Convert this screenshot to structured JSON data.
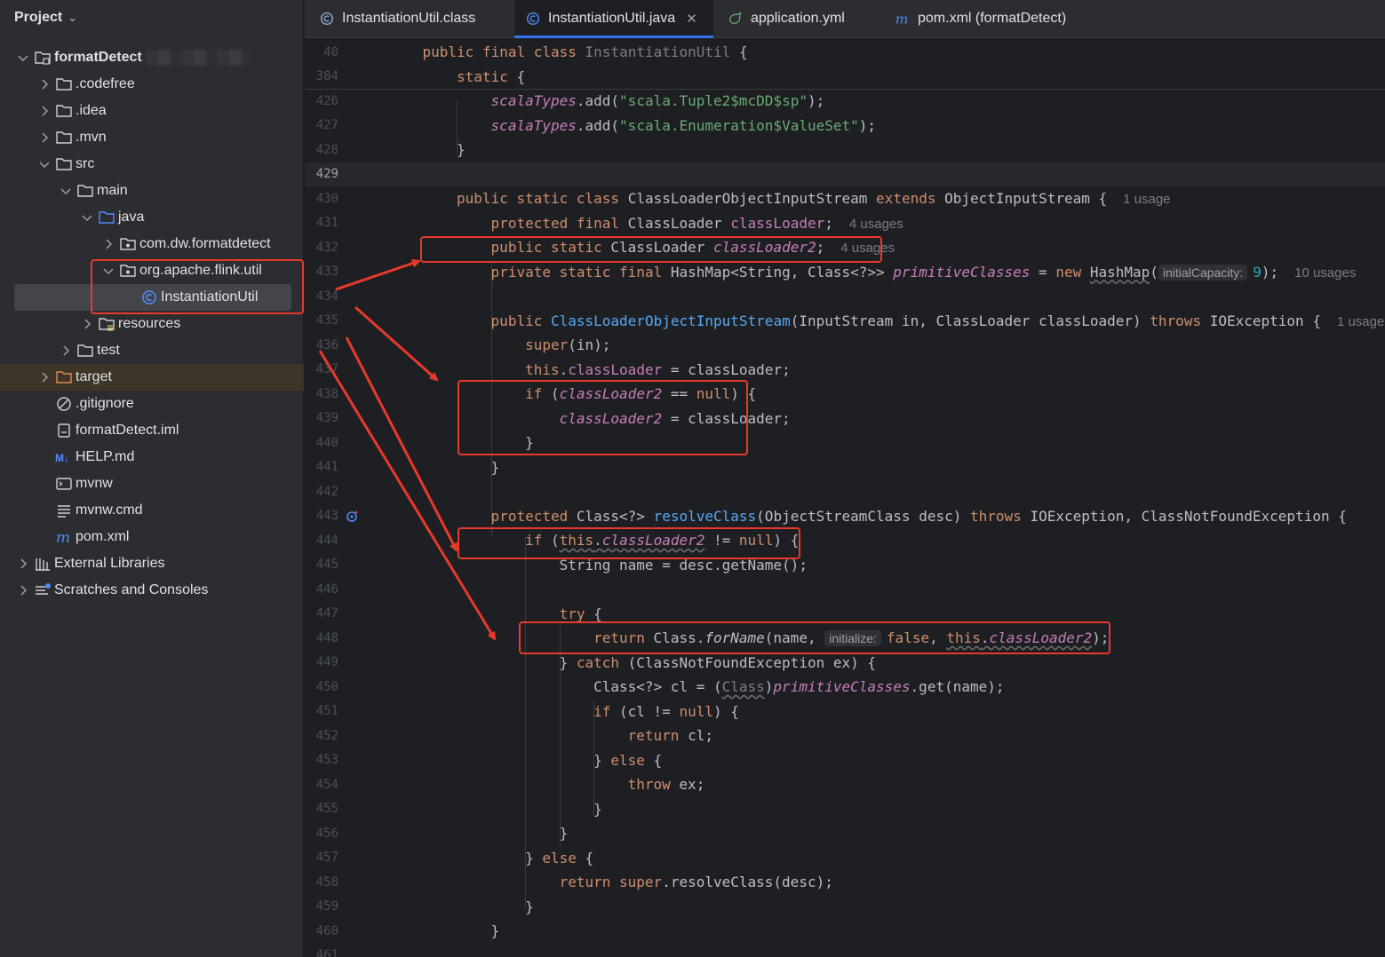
{
  "sidebar": {
    "title": "Project",
    "tree": [
      {
        "label": "formatDetect",
        "indent": 0,
        "expanded": true,
        "icon": "module-folder-icon",
        "bold": true,
        "blurred": true
      },
      {
        "label": ".codefree",
        "indent": 1,
        "expanded": false,
        "icon": "folder-icon"
      },
      {
        "label": ".idea",
        "indent": 1,
        "expanded": false,
        "icon": "folder-icon"
      },
      {
        "label": ".mvn",
        "indent": 1,
        "expanded": false,
        "icon": "folder-icon"
      },
      {
        "label": "src",
        "indent": 1,
        "expanded": true,
        "icon": "folder-icon"
      },
      {
        "label": "main",
        "indent": 2,
        "expanded": true,
        "icon": "folder-icon"
      },
      {
        "label": "java",
        "indent": 3,
        "expanded": true,
        "icon": "source-folder-icon"
      },
      {
        "label": "com.dw.formatdetect",
        "indent": 4,
        "expanded": false,
        "icon": "package-icon"
      },
      {
        "label": "org.apache.flink.util",
        "indent": 4,
        "expanded": true,
        "icon": "package-icon"
      },
      {
        "label": "InstantiationUtil",
        "indent": 5,
        "icon": "java-class-icon",
        "selected": true
      },
      {
        "label": "resources",
        "indent": 3,
        "expanded": false,
        "icon": "resources-folder-icon"
      },
      {
        "label": "test",
        "indent": 2,
        "expanded": false,
        "icon": "folder-icon"
      },
      {
        "label": "target",
        "indent": 1,
        "expanded": false,
        "icon": "excluded-folder-icon",
        "highlight": true
      },
      {
        "label": ".gitignore",
        "indent": 1,
        "icon": "ignore-file-icon"
      },
      {
        "label": "formatDetect.iml",
        "indent": 1,
        "icon": "iml-file-icon"
      },
      {
        "label": "HELP.md",
        "indent": 1,
        "icon": "markdown-icon"
      },
      {
        "label": "mvnw",
        "indent": 1,
        "icon": "terminal-file-icon"
      },
      {
        "label": "mvnw.cmd",
        "indent": 1,
        "icon": "text-file-icon"
      },
      {
        "label": "pom.xml",
        "indent": 1,
        "icon": "maven-icon"
      },
      {
        "label": "External Libraries",
        "indent": 0,
        "expanded": false,
        "icon": "libraries-icon"
      },
      {
        "label": "Scratches and Consoles",
        "indent": 0,
        "expanded": false,
        "icon": "scratches-icon"
      }
    ]
  },
  "tabs": [
    {
      "label": "InstantiationUtil.class",
      "icon": "class-file-icon"
    },
    {
      "label": "InstantiationUtil.java",
      "icon": "java-class-icon",
      "active": true
    },
    {
      "label": "application.yml",
      "icon": "yaml-icon"
    },
    {
      "label": "pom.xml (formatDetect)",
      "icon": "maven-icon"
    }
  ],
  "sticky_lines": [
    {
      "num": "40",
      "indent": 4,
      "tokens": [
        [
          "kw",
          "public final class "
        ],
        [
          "dim",
          "InstantiationUtil"
        ],
        [
          "",
          " {"
        ]
      ]
    },
    {
      "num": "384",
      "indent": 8,
      "tokens": [
        [
          "kw",
          "static"
        ],
        [
          "",
          " {"
        ]
      ]
    }
  ],
  "code_lines": [
    {
      "num": "426",
      "indent": 12,
      "tokens": [
        [
          "sfld",
          "scalaTypes"
        ],
        [
          "",
          ".add("
        ],
        [
          "str",
          "\"scala.Tuple2$mcDD$sp\""
        ],
        [
          "",
          ");"
        ]
      ]
    },
    {
      "num": "427",
      "indent": 12,
      "tokens": [
        [
          "sfld",
          "scalaTypes"
        ],
        [
          "",
          ".add("
        ],
        [
          "str",
          "\"scala.Enumeration$ValueSet\""
        ],
        [
          "",
          ");"
        ]
      ]
    },
    {
      "num": "428",
      "indent": 8,
      "tokens": [
        [
          "",
          "}"
        ]
      ]
    },
    {
      "num": "429",
      "indent": 0,
      "tokens": [],
      "current": true
    },
    {
      "num": "430",
      "indent": 8,
      "tokens": [
        [
          "kw",
          "public static class "
        ],
        [
          "",
          "ClassLoaderObjectInputStream "
        ],
        [
          "kw",
          "extends "
        ],
        [
          "",
          "ObjectInputStream {"
        ]
      ],
      "usage": "1 usage"
    },
    {
      "num": "431",
      "indent": 12,
      "tokens": [
        [
          "kw",
          "protected final "
        ],
        [
          "",
          "ClassLoader "
        ],
        [
          "fld",
          "classLoader"
        ],
        [
          "",
          ";"
        ]
      ],
      "usage": "4 usages"
    },
    {
      "num": "432",
      "indent": 12,
      "tokens": [
        [
          "kw",
          "public static "
        ],
        [
          "",
          "ClassLoader "
        ],
        [
          "sfld",
          "classLoader2"
        ],
        [
          "",
          ";"
        ]
      ],
      "usage": "4 usages"
    },
    {
      "num": "433",
      "indent": 12,
      "tokens": [
        [
          "kw",
          "private static final "
        ],
        [
          "",
          "HashMap<String, Class<?>> "
        ],
        [
          "sfld",
          "primitiveClasses"
        ],
        [
          "",
          " = "
        ],
        [
          "kw",
          "new "
        ],
        [
          "wavy",
          "HashMap"
        ],
        [
          "",
          "("
        ],
        [
          "hint",
          "initialCapacity:"
        ],
        [
          "num",
          "9"
        ],
        [
          "",
          ");"
        ]
      ],
      "usage": "10 usages"
    },
    {
      "num": "434",
      "indent": 0,
      "tokens": []
    },
    {
      "num": "435",
      "indent": 12,
      "tokens": [
        [
          "kw",
          "public "
        ],
        [
          "mth",
          "ClassLoaderObjectInputStream"
        ],
        [
          "",
          "(InputStream in, ClassLoader classLoader) "
        ],
        [
          "kw",
          "throws "
        ],
        [
          "",
          "IOException {"
        ]
      ],
      "usage": "1 usage"
    },
    {
      "num": "436",
      "indent": 16,
      "tokens": [
        [
          "kw",
          "super"
        ],
        [
          "",
          "(in);"
        ]
      ]
    },
    {
      "num": "437",
      "indent": 16,
      "tokens": [
        [
          "kw",
          "this"
        ],
        [
          "",
          "."
        ],
        [
          "fld",
          "classLoader"
        ],
        [
          "",
          " = classLoader;"
        ]
      ]
    },
    {
      "num": "438",
      "indent": 16,
      "tokens": [
        [
          "kw",
          "if "
        ],
        [
          "",
          "("
        ],
        [
          "sfld",
          "classLoader2"
        ],
        [
          "",
          " == "
        ],
        [
          "kw",
          "null"
        ],
        [
          "",
          ") {"
        ]
      ]
    },
    {
      "num": "439",
      "indent": 20,
      "tokens": [
        [
          "sfld",
          "classLoader2"
        ],
        [
          "",
          " = classLoader;"
        ]
      ]
    },
    {
      "num": "440",
      "indent": 16,
      "tokens": [
        [
          "",
          "}"
        ]
      ]
    },
    {
      "num": "441",
      "indent": 12,
      "tokens": [
        [
          "",
          "}"
        ]
      ]
    },
    {
      "num": "442",
      "indent": 0,
      "tokens": []
    },
    {
      "num": "443",
      "indent": 12,
      "tokens": [
        [
          "kw",
          "protected "
        ],
        [
          "",
          "Class<?> "
        ],
        [
          "mth",
          "resolveClass"
        ],
        [
          "",
          "(ObjectStreamClass desc) "
        ],
        [
          "kw",
          "throws "
        ],
        [
          "",
          "IOException, ClassNotFoundException {"
        ]
      ],
      "override": true
    },
    {
      "num": "444",
      "indent": 16,
      "tokens": [
        [
          "kw",
          "if "
        ],
        [
          "",
          "("
        ],
        [
          "kwwavy",
          "this"
        ],
        [
          "wavy",
          "."
        ],
        [
          "sfldwavy",
          "classLoader2"
        ],
        [
          "",
          " != "
        ],
        [
          "kw",
          "null"
        ],
        [
          "",
          ") {"
        ]
      ]
    },
    {
      "num": "445",
      "indent": 20,
      "tokens": [
        [
          "",
          "String name = desc.getName();"
        ]
      ]
    },
    {
      "num": "446",
      "indent": 0,
      "tokens": []
    },
    {
      "num": "447",
      "indent": 20,
      "tokens": [
        [
          "kw",
          "try "
        ],
        [
          "",
          "{"
        ]
      ]
    },
    {
      "num": "448",
      "indent": 24,
      "tokens": [
        [
          "kw",
          "return "
        ],
        [
          "",
          "Class."
        ],
        [
          "smth",
          "forName"
        ],
        [
          "",
          "(name, "
        ],
        [
          "hint",
          "initialize:"
        ],
        [
          "kw",
          "false"
        ],
        [
          "",
          ", "
        ],
        [
          "kwwavy",
          "this"
        ],
        [
          "wavy",
          "."
        ],
        [
          "sfldwavy",
          "classLoader2"
        ],
        [
          "",
          ");"
        ]
      ]
    },
    {
      "num": "449",
      "indent": 20,
      "tokens": [
        [
          "",
          "} "
        ],
        [
          "kw",
          "catch "
        ],
        [
          "",
          "(ClassNotFoundException ex) {"
        ]
      ]
    },
    {
      "num": "450",
      "indent": 24,
      "tokens": [
        [
          "",
          "Class<?> cl = ("
        ],
        [
          "dimwavy",
          "Class"
        ],
        [
          "",
          ")"
        ],
        [
          "sfld",
          "primitiveClasses"
        ],
        [
          "",
          ".get(name);"
        ]
      ]
    },
    {
      "num": "451",
      "indent": 24,
      "tokens": [
        [
          "kw",
          "if "
        ],
        [
          "",
          "(cl != "
        ],
        [
          "kw",
          "null"
        ],
        [
          "",
          ") {"
        ]
      ]
    },
    {
      "num": "452",
      "indent": 28,
      "tokens": [
        [
          "kw",
          "return "
        ],
        [
          "",
          "cl;"
        ]
      ]
    },
    {
      "num": "453",
      "indent": 24,
      "tokens": [
        [
          "",
          "} "
        ],
        [
          "kw",
          "else "
        ],
        [
          "",
          "{"
        ]
      ]
    },
    {
      "num": "454",
      "indent": 28,
      "tokens": [
        [
          "kw",
          "throw "
        ],
        [
          "",
          "ex;"
        ]
      ]
    },
    {
      "num": "455",
      "indent": 24,
      "tokens": [
        [
          "",
          "}"
        ]
      ]
    },
    {
      "num": "456",
      "indent": 20,
      "tokens": [
        [
          "",
          "}"
        ]
      ]
    },
    {
      "num": "457",
      "indent": 16,
      "tokens": [
        [
          "",
          "} "
        ],
        [
          "kw",
          "else "
        ],
        [
          "",
          "{"
        ]
      ]
    },
    {
      "num": "458",
      "indent": 20,
      "tokens": [
        [
          "kw",
          "return super"
        ],
        [
          "",
          ".resolveClass(desc);"
        ]
      ]
    },
    {
      "num": "459",
      "indent": 16,
      "tokens": [
        [
          "",
          "}"
        ]
      ]
    },
    {
      "num": "460",
      "indent": 12,
      "tokens": [
        [
          "",
          "}"
        ]
      ]
    },
    {
      "num": "461",
      "indent": 0,
      "tokens": []
    }
  ],
  "colors": {
    "accent": "#3574f0",
    "annotation": "#e8392c",
    "keyword": "#cf8e6d",
    "string": "#6aab73",
    "field": "#c77dbb",
    "method": "#56a8f5"
  }
}
